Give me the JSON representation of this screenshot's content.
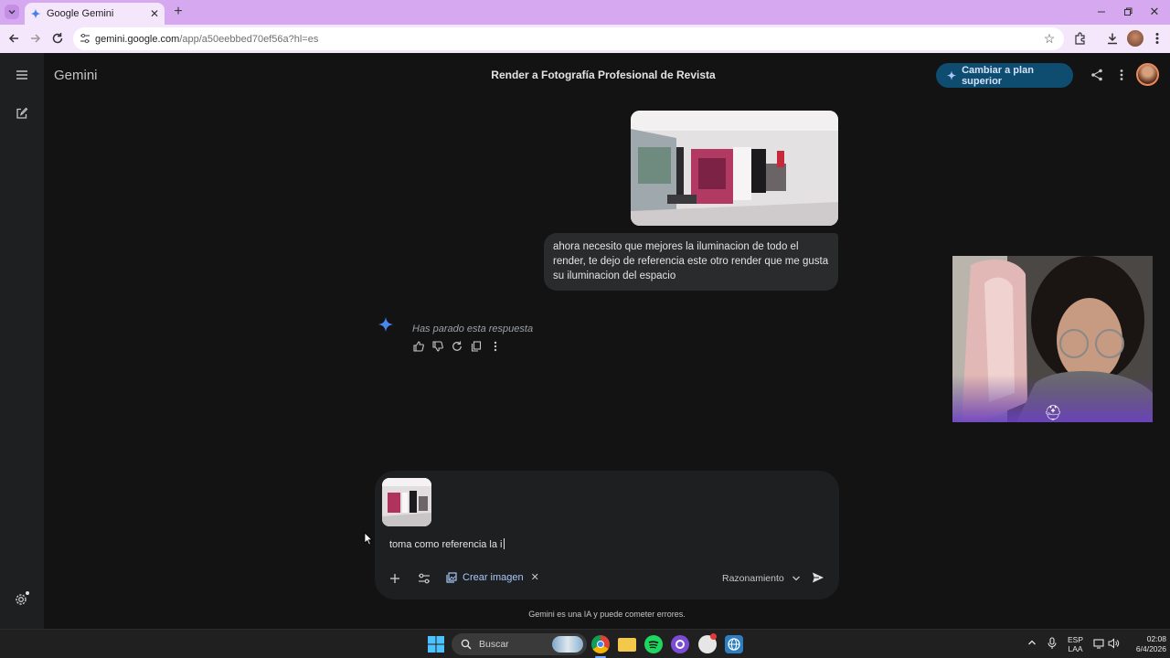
{
  "browser": {
    "tab_title": "Google Gemini",
    "url_host": "gemini.google.com",
    "url_path": "/app/a50eebbed70ef56a?hl=es"
  },
  "app": {
    "brand": "Gemini",
    "conversation_title": "Render a Fotografía Profesional de Revista",
    "upgrade_label": "Cambiar a plan superior"
  },
  "conversation": {
    "user_message": "ahora necesito que mejores la iluminacion de todo el render, te dejo de referencia este otro render que me gusta su iluminacion del espacio",
    "response_status": "Has parado esta respuesta"
  },
  "composer": {
    "prompt_text": "toma como referencia la i",
    "tool_chip": "Crear imagen",
    "mode_label": "Razonamiento"
  },
  "disclaimer": "Gemini es una IA y puede cometer errores.",
  "taskbar": {
    "search_label": "Buscar",
    "lang_line1": "ESP",
    "lang_line2": "LAA",
    "time": "02:08",
    "date": "6/4/2026"
  },
  "colors": {
    "tab_strip": "#d6a8f0",
    "toolbar": "#f4e6fb",
    "app_bg": "#131314",
    "upgrade_bg": "#0e4d70",
    "accent_blue": "#a8c7fa"
  }
}
